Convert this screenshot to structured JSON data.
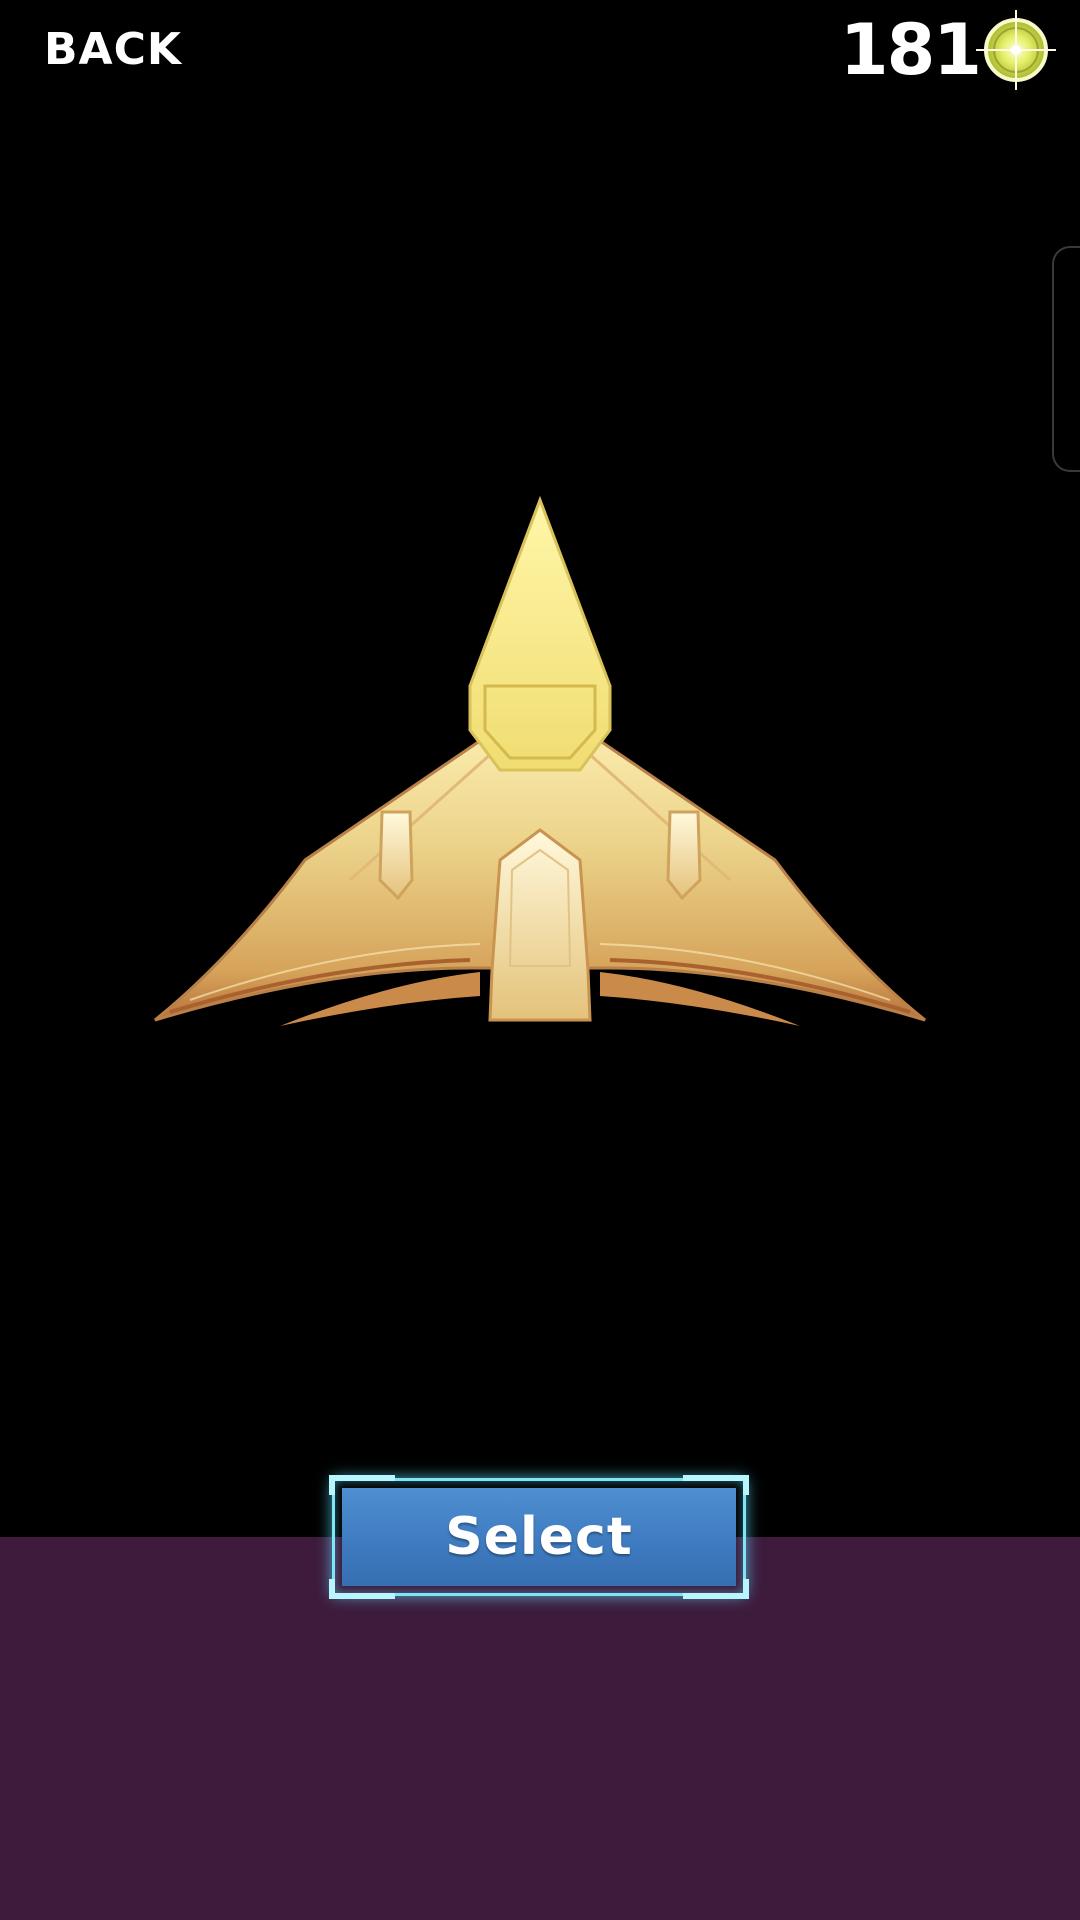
{
  "header": {
    "back_label": "BACK",
    "coin_count": "181",
    "coin_icon": "crosshair-coin-icon"
  },
  "ship": {
    "icon": "spaceship-icon"
  },
  "actions": {
    "select_label": "Select"
  },
  "colors": {
    "background": "#000000",
    "bottom_panel": "#3e1b3c",
    "button_fill": "#3f7bc0",
    "button_border": "#7fe6f5",
    "ship_gold": "#e8cf7a"
  }
}
